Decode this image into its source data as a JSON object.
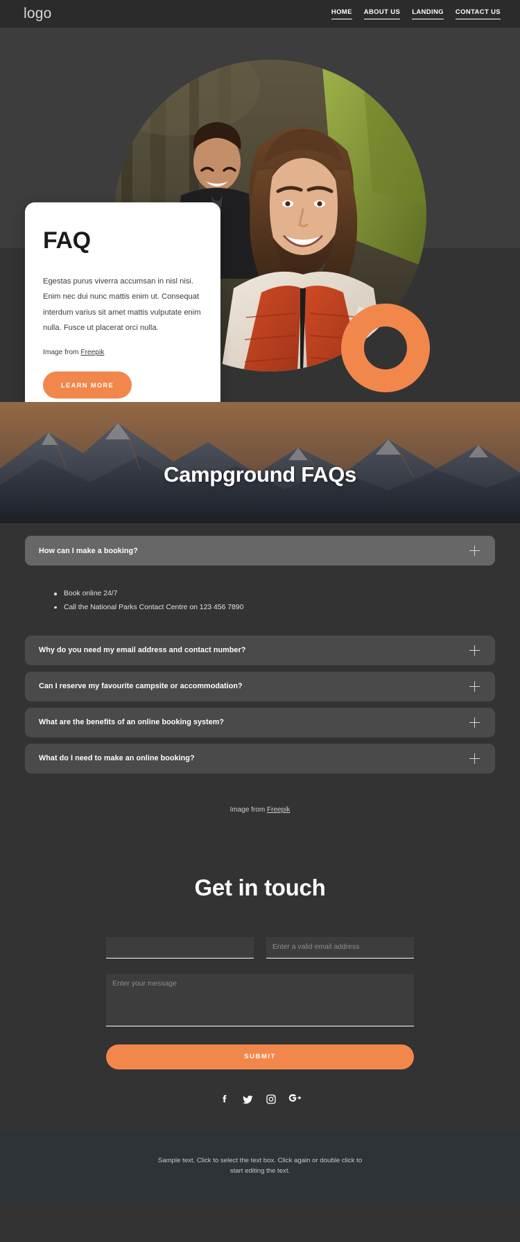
{
  "header": {
    "logo": "logo",
    "nav": [
      {
        "label": "HOME"
      },
      {
        "label": "ABOUT US"
      },
      {
        "label": "LANDING"
      },
      {
        "label": "CONTACT US"
      }
    ]
  },
  "hero": {
    "card": {
      "title": "FAQ",
      "body": "Egestas purus viverra accumsan in nisl nisi. Enim nec dui nunc mattis enim ut. Consequat interdum varius sit amet mattis vulputate enim nulla. Fusce ut placerat orci nulla.",
      "credit_prefix": "Image from ",
      "credit_link": "Freepik",
      "button": "LEARN MORE"
    },
    "shapes": {
      "ring_color": "#f2874c"
    },
    "photo_alt": "couple-camping-selfie-photo"
  },
  "faq_section": {
    "title": "Campground FAQs",
    "items": [
      {
        "question": "How can I make a booking?",
        "open": true,
        "answers": [
          "Book online 24/7",
          "Call the National Parks Contact Centre on 123 456 7890"
        ]
      },
      {
        "question": "Why do you need my email address and contact number?",
        "open": false,
        "answers": []
      },
      {
        "question": "Can I reserve my favourite campsite or accommodation?",
        "open": false,
        "answers": []
      },
      {
        "question": "What are the benefits of an online booking system?",
        "open": false,
        "answers": []
      },
      {
        "question": "What do I need to make an online booking?",
        "open": false,
        "answers": []
      }
    ],
    "credit_prefix": "Image from ",
    "credit_link": "Freepik"
  },
  "contact": {
    "title": "Get in touch",
    "name_value": "",
    "name_placeholder": "",
    "email_placeholder": "Enter a valid email address",
    "email_value": "",
    "message_placeholder": "Enter your message",
    "message_value": "",
    "submit_label": "SUBMIT",
    "socials": [
      {
        "name": "facebook"
      },
      {
        "name": "twitter"
      },
      {
        "name": "instagram"
      },
      {
        "name": "google-plus"
      }
    ]
  },
  "footer": {
    "text": "Sample text. Click to select the text box. Click again or double click to start editing the text."
  },
  "colors": {
    "accent": "#f2874c",
    "page_bg": "#333333",
    "header_bg": "#2b2b2b",
    "footer_bg": "#2e3338",
    "accordion_bg": "#4a4a4a",
    "accordion_open_bg": "#676767"
  }
}
